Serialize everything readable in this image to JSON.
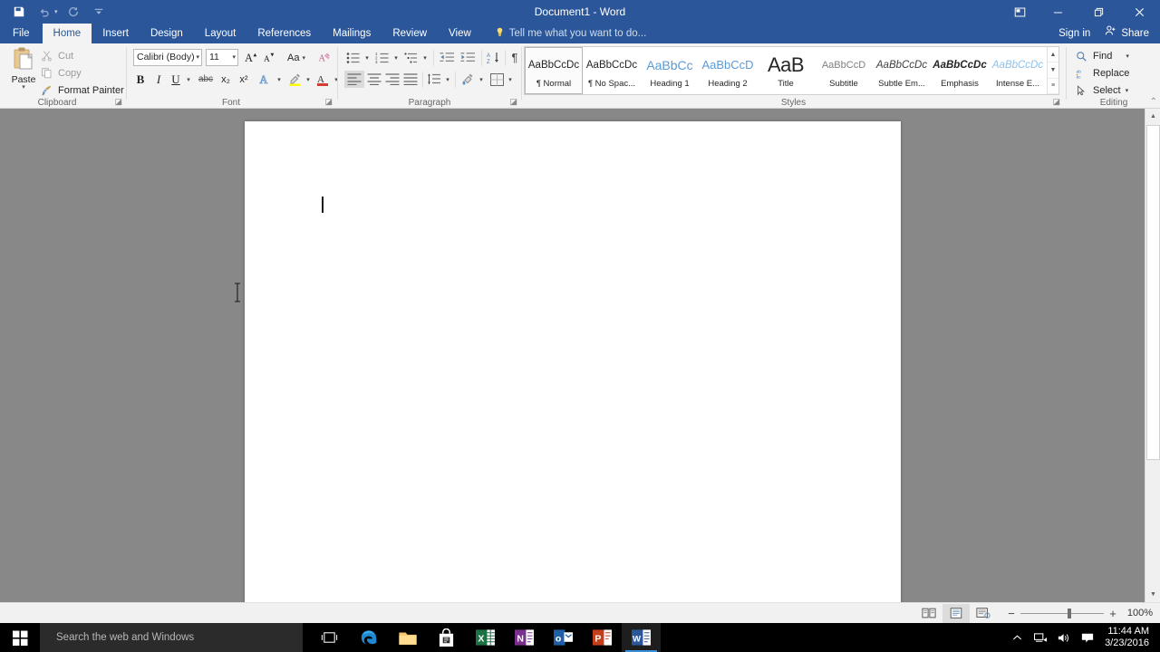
{
  "titlebar": {
    "document_title": "Document1 - Word",
    "qat": [
      {
        "name": "save-icon",
        "glyph": "save",
        "enabled": true
      },
      {
        "name": "undo-icon",
        "glyph": "undo",
        "enabled": false
      },
      {
        "name": "redo-icon",
        "glyph": "redo",
        "enabled": false
      },
      {
        "name": "customize-qat-icon",
        "glyph": "chevron",
        "enabled": true
      }
    ],
    "ribbon_display_options": "▣",
    "minimize": "—",
    "restore": "❐",
    "close": "✕"
  },
  "tabs": {
    "file": "File",
    "items": [
      "Home",
      "Insert",
      "Design",
      "Layout",
      "References",
      "Mailings",
      "Review",
      "View"
    ],
    "active": "Home",
    "tell_me": "Tell me what you want to do...",
    "sign_in": "Sign in",
    "share": "Share"
  },
  "ribbon": {
    "clipboard": {
      "group_label": "Clipboard",
      "paste": "Paste",
      "cut": "Cut",
      "copy": "Copy",
      "format_painter": "Format Painter"
    },
    "font": {
      "group_label": "Font",
      "font_name": "Calibri (Body)",
      "font_size": "11",
      "buttons": [
        "Grow Font",
        "Shrink Font",
        "Change Case",
        "Clear All Formatting",
        "Bold",
        "Italic",
        "Underline",
        "Strikethrough",
        "Subscript",
        "Superscript",
        "Text Effects and Typography",
        "Text Highlight Color",
        "Font Color"
      ],
      "bold": "B",
      "italic": "I",
      "underline": "U",
      "strikethrough": "abc",
      "subscript": "x₂",
      "superscript": "x²",
      "grow_font": "A",
      "shrink_font": "A",
      "change_case": "Aa"
    },
    "paragraph": {
      "group_label": "Paragraph",
      "buttons": [
        "Bullets",
        "Numbering",
        "Multilevel List",
        "Decrease Indent",
        "Increase Indent",
        "Sort",
        "Show/Hide ¶",
        "Align Left",
        "Center",
        "Align Right",
        "Justify",
        "Line and Paragraph Spacing",
        "Shading",
        "Borders"
      ],
      "pilcrow": "¶"
    },
    "styles": {
      "group_label": "Styles",
      "items": [
        {
          "preview": "AaBbCcDc",
          "name": "Normal",
          "selected": true,
          "marker": "¶",
          "color": "#262626",
          "italic": false,
          "bold": false,
          "size": 11.5
        },
        {
          "preview": "AaBbCcDc",
          "name": "No Spac...",
          "selected": false,
          "marker": "¶",
          "color": "#262626",
          "italic": false,
          "bold": false,
          "size": 11.5
        },
        {
          "preview": "AaBbCc",
          "name": "Heading 1",
          "selected": false,
          "marker": "",
          "color": "#5b9bd5",
          "italic": false,
          "bold": false,
          "size": 14
        },
        {
          "preview": "AaBbCcD",
          "name": "Heading 2",
          "selected": false,
          "marker": "",
          "color": "#5b9bd5",
          "italic": false,
          "bold": false,
          "size": 13
        },
        {
          "preview": "AaB",
          "name": "Title",
          "selected": false,
          "marker": "",
          "color": "#262626",
          "italic": false,
          "bold": false,
          "size": 22
        },
        {
          "preview": "AaBbCcD",
          "name": "Subtitle",
          "selected": false,
          "marker": "",
          "color": "#808080",
          "italic": false,
          "bold": false,
          "size": 11
        },
        {
          "preview": "AaBbCcDc",
          "name": "Subtle Em...",
          "selected": false,
          "marker": "",
          "color": "#404040",
          "italic": true,
          "bold": false,
          "size": 11.5
        },
        {
          "preview": "AaBbCcDc",
          "name": "Emphasis",
          "selected": false,
          "marker": "",
          "color": "#262626",
          "italic": true,
          "bold": true,
          "size": 11.5
        },
        {
          "preview": "AaBbCcDc",
          "name": "Intense E...",
          "selected": false,
          "marker": "",
          "color": "#8fc0e8",
          "italic": true,
          "bold": false,
          "size": 11.5
        }
      ],
      "scroll_up": "▲",
      "scroll_down": "▼",
      "more": "▾"
    },
    "editing": {
      "group_label": "Editing",
      "find": "Find",
      "replace": "Replace",
      "select": "Select",
      "collapse_ribbon": "^"
    }
  },
  "document": {
    "body_text": "",
    "caret_visible": true
  },
  "statusbar": {
    "views": [
      "Read Mode",
      "Print Layout",
      "Web Layout"
    ],
    "active_view": "Print Layout",
    "zoom_out": "−",
    "zoom_in": "+",
    "zoom_level": "100%"
  },
  "taskbar": {
    "start": "start-icon",
    "search_placeholder": "Search the web and Windows",
    "apps": [
      {
        "name": "task-view",
        "label": "Task View"
      },
      {
        "name": "edge",
        "label": "Microsoft Edge"
      },
      {
        "name": "file-explorer",
        "label": "File Explorer"
      },
      {
        "name": "store",
        "label": "Store"
      },
      {
        "name": "excel",
        "label": "Excel"
      },
      {
        "name": "onenote",
        "label": "OneNote"
      },
      {
        "name": "outlook",
        "label": "Outlook"
      },
      {
        "name": "powerpoint",
        "label": "PowerPoint"
      },
      {
        "name": "word",
        "label": "Word",
        "active": true
      }
    ],
    "tray": [
      "show-hidden-icons",
      "network",
      "volume",
      "action-center"
    ],
    "time": "11:44 AM",
    "date": "3/23/2016"
  },
  "colors": {
    "word_blue": "#2b579a",
    "ribbon_bg": "#f3f3f3",
    "doc_bg": "#868686",
    "accent_blue": "#5b9bd5"
  }
}
